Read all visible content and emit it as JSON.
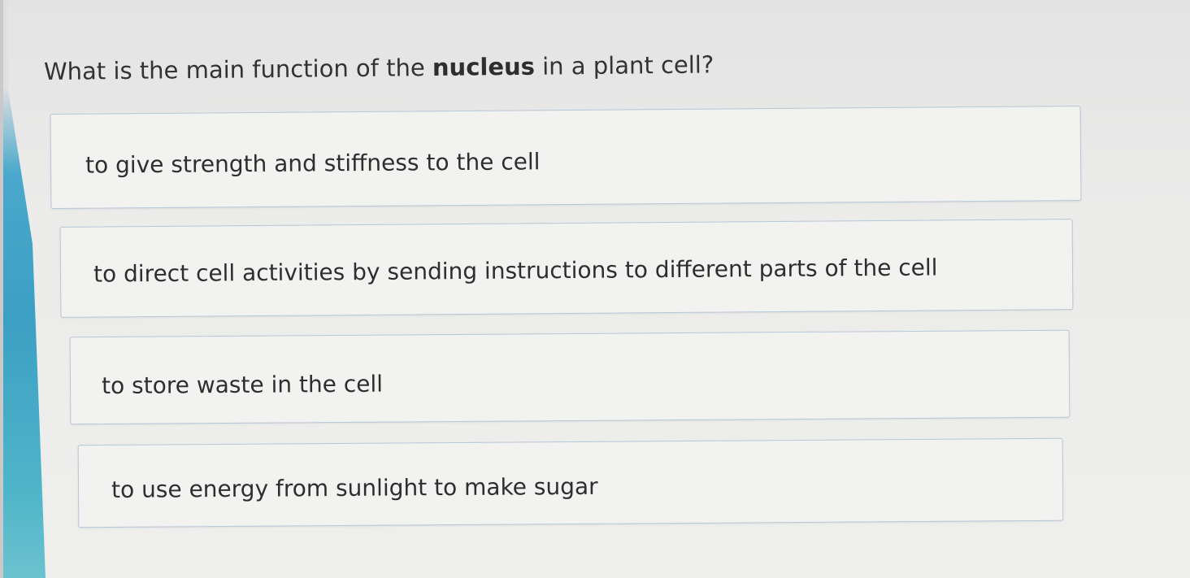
{
  "question": {
    "prefix": "What is the main function of the ",
    "emphasis": "nucleus",
    "suffix": " in a plant cell?"
  },
  "options": [
    {
      "label": "to give strength and stiffness to the cell"
    },
    {
      "label": "to direct cell activities by sending instructions to different parts of the cell"
    },
    {
      "label": "to store waste in the cell"
    },
    {
      "label": "to use energy from sunlight to make sugar"
    }
  ],
  "colors": {
    "accent_edge": "#3c9fc4",
    "option_border": "#b8c7d6",
    "option_background": "#f2f2f1"
  }
}
